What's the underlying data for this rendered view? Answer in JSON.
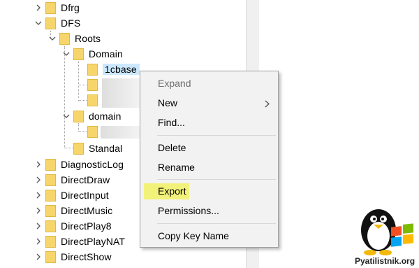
{
  "tree": {
    "items": [
      {
        "label": "Dfrg"
      },
      {
        "label": "DFS"
      },
      {
        "label": "Roots"
      },
      {
        "label": "Domain"
      },
      {
        "label": "1cbase"
      },
      {
        "label": "domain"
      },
      {
        "label": "Standal"
      },
      {
        "label": "DiagnosticLog"
      },
      {
        "label": "DirectDraw"
      },
      {
        "label": "DirectInput"
      },
      {
        "label": "DirectMusic"
      },
      {
        "label": "DirectPlay8"
      },
      {
        "label": "DirectPlayNAT"
      },
      {
        "label": "DirectShow"
      }
    ]
  },
  "context_menu": {
    "items": [
      {
        "label": "Expand"
      },
      {
        "label": "New"
      },
      {
        "label": "Find..."
      },
      {
        "label": "Delete"
      },
      {
        "label": "Rename"
      },
      {
        "label": "Export"
      },
      {
        "label": "Permissions..."
      },
      {
        "label": "Copy Key Name"
      }
    ],
    "highlight_color": "#f2f27a"
  },
  "watermark": {
    "text": "Pyatilistnik.org"
  }
}
